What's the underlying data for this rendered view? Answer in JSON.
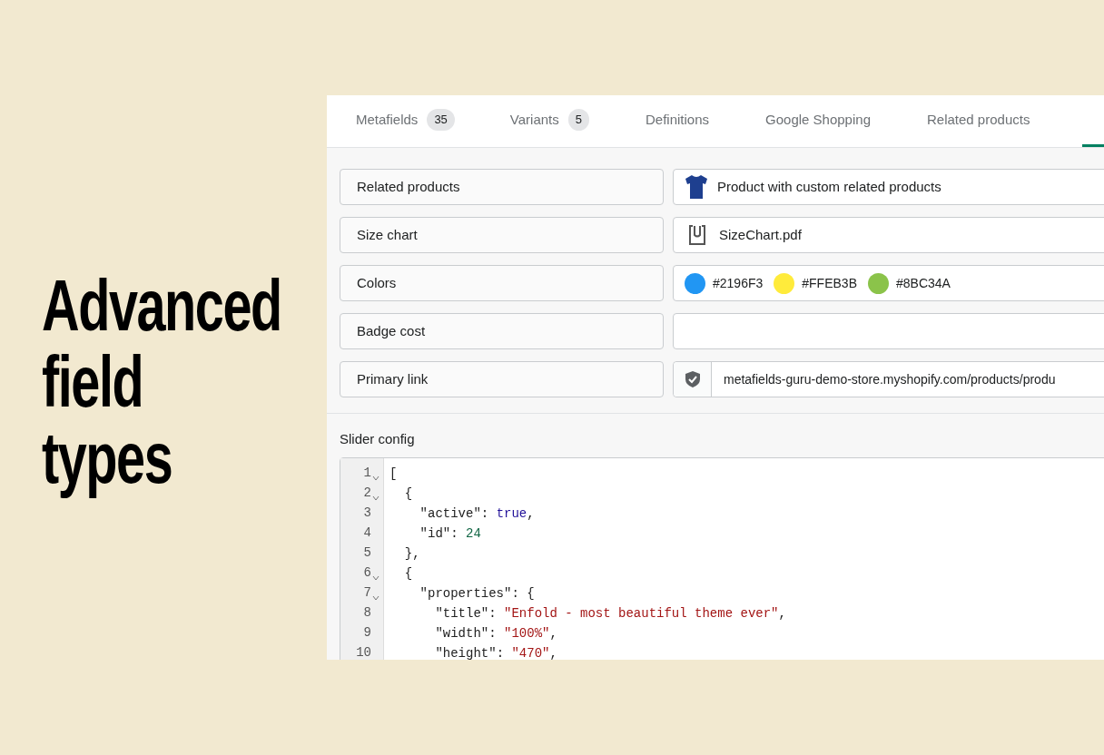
{
  "headline": [
    "Advanced",
    "field",
    "types"
  ],
  "tabs": [
    {
      "label": "Metafields",
      "count": "35",
      "selected": false
    },
    {
      "label": "Variants",
      "count": "5",
      "selected": false
    },
    {
      "label": "Definitions",
      "selected": false
    },
    {
      "label": "Google Shopping",
      "selected": false
    },
    {
      "label": "Related products",
      "selected": false
    }
  ],
  "fields": [
    {
      "label": "Related products",
      "kind": "product",
      "value": "Product with custom related products"
    },
    {
      "label": "Size chart",
      "kind": "file",
      "value": "SizeChart.pdf"
    },
    {
      "label": "Colors",
      "kind": "colors",
      "colors": [
        {
          "value": "#2196F3",
          "color": "#2196f3"
        },
        {
          "value": "#FFEB3B",
          "color": "#ffeb3b"
        },
        {
          "value": "#8BC34A",
          "color": "#8bc34a"
        }
      ]
    },
    {
      "label": "Badge cost",
      "kind": "text"
    },
    {
      "label": "Primary link",
      "kind": "url",
      "value": "metafields-guru-demo-store.myshopify.com/products/produ"
    }
  ],
  "code_field": {
    "label": "Slider config",
    "lines": [
      {
        "number": "1",
        "foldable": true,
        "tokens": [
          {
            "kind": "punct",
            "text": "["
          }
        ]
      },
      {
        "number": "2",
        "foldable": true,
        "tokens": [
          {
            "kind": "punct",
            "text": "  {"
          }
        ]
      },
      {
        "number": "3",
        "foldable": false,
        "tokens": [
          {
            "kind": "key",
            "text": "    \"active\""
          },
          {
            "kind": "punct",
            "text": ": "
          },
          {
            "kind": "bool",
            "text": "true"
          },
          {
            "kind": "punct",
            "text": ","
          }
        ]
      },
      {
        "number": "4",
        "foldable": false,
        "tokens": [
          {
            "kind": "key",
            "text": "    \"id\""
          },
          {
            "kind": "punct",
            "text": ": "
          },
          {
            "kind": "number",
            "text": "24"
          }
        ]
      },
      {
        "number": "5",
        "foldable": false,
        "tokens": [
          {
            "kind": "punct",
            "text": "  },"
          }
        ]
      },
      {
        "number": "6",
        "foldable": true,
        "tokens": [
          {
            "kind": "punct",
            "text": "  {"
          }
        ]
      },
      {
        "number": "7",
        "foldable": true,
        "tokens": [
          {
            "kind": "key",
            "text": "    \"properties\""
          },
          {
            "kind": "punct",
            "text": ": {"
          }
        ]
      },
      {
        "number": "8",
        "foldable": false,
        "tokens": [
          {
            "kind": "key",
            "text": "      \"title\""
          },
          {
            "kind": "punct",
            "text": ": "
          },
          {
            "kind": "string",
            "text": "\"Enfold - most beautiful theme ever\""
          },
          {
            "kind": "punct",
            "text": ","
          }
        ]
      },
      {
        "number": "9",
        "foldable": false,
        "tokens": [
          {
            "kind": "key",
            "text": "      \"width\""
          },
          {
            "kind": "punct",
            "text": ": "
          },
          {
            "kind": "string",
            "text": "\"100%\""
          },
          {
            "kind": "punct",
            "text": ","
          }
        ]
      },
      {
        "number": "10",
        "foldable": false,
        "tokens": [
          {
            "kind": "key",
            "text": "      \"height\""
          },
          {
            "kind": "punct",
            "text": ": "
          },
          {
            "kind": "string",
            "text": "\"470\""
          },
          {
            "kind": "punct",
            "text": ","
          }
        ]
      }
    ]
  }
}
